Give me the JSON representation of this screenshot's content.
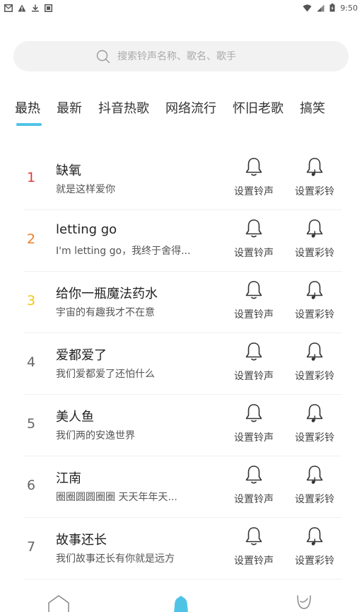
{
  "status_bar": {
    "time": "9:50",
    "left_icons": [
      "mail-icon",
      "warning-icon",
      "download-icon",
      "app-icon"
    ],
    "right_icons": [
      "wifi-icon",
      "signal-icon",
      "battery-icon"
    ]
  },
  "search": {
    "placeholder": "搜索铃声名称、歌名、歌手"
  },
  "tabs": [
    {
      "label": "最热",
      "active": true
    },
    {
      "label": "最新",
      "active": false
    },
    {
      "label": "抖音热歌",
      "active": false
    },
    {
      "label": "网络流行",
      "active": false
    },
    {
      "label": "怀旧老歌",
      "active": false
    },
    {
      "label": "搞笑",
      "active": false
    }
  ],
  "actions": {
    "set_ringtone": "设置铃声",
    "set_crbt": "设置彩铃"
  },
  "songs": [
    {
      "rank": "1",
      "title": "缺氧",
      "subtitle": "就是这样爱你",
      "rank_color": "#e53935"
    },
    {
      "rank": "2",
      "title": "letting go",
      "subtitle": "I'm letting go，我终于舍得...",
      "rank_color": "#ef7d22"
    },
    {
      "rank": "3",
      "title": "给你一瓶魔法药水",
      "subtitle": "宇宙的有趣我才不在意",
      "rank_color": "#f5c518"
    },
    {
      "rank": "4",
      "title": "爱都爱了",
      "subtitle": "我们爱都爱了还怕什么",
      "rank_color": "#666666"
    },
    {
      "rank": "5",
      "title": "美人鱼",
      "subtitle": "我们两的安逸世界",
      "rank_color": "#666666"
    },
    {
      "rank": "6",
      "title": "江南",
      "subtitle": "圈圈圆圆圈圈 天天年年天...",
      "rank_color": "#666666"
    },
    {
      "rank": "7",
      "title": "故事还长",
      "subtitle": "我们故事还长有你就是远方",
      "rank_color": "#666666"
    }
  ],
  "bottom_nav": [
    {
      "icon": "home-icon",
      "active": false
    },
    {
      "icon": "bell-icon",
      "active": true
    },
    {
      "icon": "profile-icon",
      "active": false
    }
  ],
  "colors": {
    "accent": "#4fc3e6",
    "search_bg": "#f2f2f2"
  }
}
